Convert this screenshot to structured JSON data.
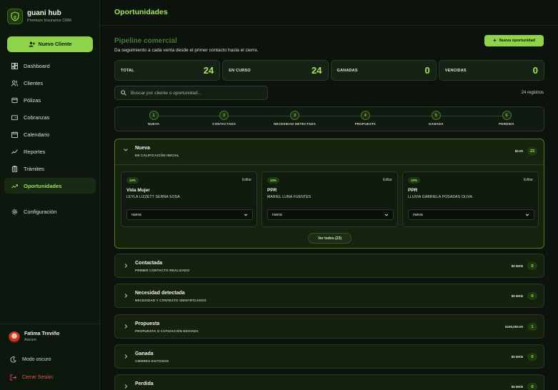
{
  "app": {
    "brand_title": "guani hub",
    "brand_subtitle": "Premium Insurance CRM",
    "new_client_label": "Nuevo Cliente"
  },
  "nav": [
    {
      "label": "Dashboard",
      "icon": "dashboard-icon",
      "active": false
    },
    {
      "label": "Clientes",
      "icon": "users-icon",
      "active": false
    },
    {
      "label": "Pólizas",
      "icon": "policy-icon",
      "active": false
    },
    {
      "label": "Cobranzas",
      "icon": "wallet-icon",
      "active": false
    },
    {
      "label": "Calendario",
      "icon": "calendar-icon",
      "active": false
    },
    {
      "label": "Reportes",
      "icon": "chart-line-icon",
      "active": false
    },
    {
      "label": "Trámites",
      "icon": "clipboard-icon",
      "active": false
    },
    {
      "label": "Oportunidades",
      "icon": "trend-up-icon",
      "active": true
    }
  ],
  "settings_label": "Configuración",
  "user": {
    "name": "Fatima Treviño",
    "role": "Asesor"
  },
  "dark_mode_label": "Modo oscuro",
  "logout_label": "Cerrar Sesión",
  "page": {
    "title": "Oportunidades",
    "section_title": "Pipeline comercial",
    "section_subtitle": "Da seguimiento a cada venta desde el primer contacto hasta el cierre.",
    "new_opportunity_label": "Nueva oportunidad"
  },
  "stats": [
    {
      "label": "TOTAL",
      "value": "24"
    },
    {
      "label": "EN CURSO",
      "value": "24"
    },
    {
      "label": "GANADAS",
      "value": "0"
    },
    {
      "label": "VENCIDAS",
      "value": "0"
    }
  ],
  "search": {
    "placeholder": "Buscar por cliente o oportunidad...",
    "count_text": "24 registros"
  },
  "steps": [
    {
      "number": "1",
      "label": "NUEVA"
    },
    {
      "number": "2",
      "label": "CONTACTADA"
    },
    {
      "number": "3",
      "label": "NECESIDAD DETECTADA"
    },
    {
      "number": "4",
      "label": "PROPUESTA"
    },
    {
      "number": "5",
      "label": "GANADA"
    },
    {
      "number": "6",
      "label": "PERDIDA"
    }
  ],
  "open_stage": {
    "title": "Nueva",
    "subtitle": "EN CALIFICACIÓN INICIAL",
    "amount": "$0.00",
    "count": "23",
    "cards": [
      {
        "pct": "10%",
        "edit": "Editar",
        "title": "Vida Mujer",
        "client": "LEYLA LIZZETT SERNA SOSA",
        "status": "nueva"
      },
      {
        "pct": "10%",
        "edit": "Editar",
        "title": "PPR",
        "client": "MARIEL LUNA FUENTES",
        "status": "nueva"
      },
      {
        "pct": "10%",
        "edit": "Editar",
        "title": "PPR",
        "client": "LLUVIA GABRIELA POSADAS OLIVA",
        "status": "nueva"
      }
    ],
    "see_all_label": "Ver todos (23)"
  },
  "stages": [
    {
      "title": "Contactada",
      "subtitle": "PRIMER CONTACTO REALIZADO",
      "amount": "$0 MXN",
      "count": "0"
    },
    {
      "title": "Necesidad detectada",
      "subtitle": "NECESIDAD Y CONTEXTO IDENTIFICADOS",
      "amount": "$0 MXN",
      "count": "0"
    },
    {
      "title": "Propuesta",
      "subtitle": "PROPUESTA O COTIZACIÓN ENVIADA",
      "amount": "$100,000.00",
      "count": "1"
    },
    {
      "title": "Ganada",
      "subtitle": "CIERRES EXITOSOS",
      "amount": "$0 MXN",
      "count": "0"
    },
    {
      "title": "Perdida",
      "subtitle": "",
      "amount": "$0 MXN",
      "count": "0"
    }
  ],
  "colors": {
    "accent": "#8fd34a",
    "accent_text": "#a6e35f",
    "background": "#0c130c",
    "danger": "#e05a4d"
  }
}
